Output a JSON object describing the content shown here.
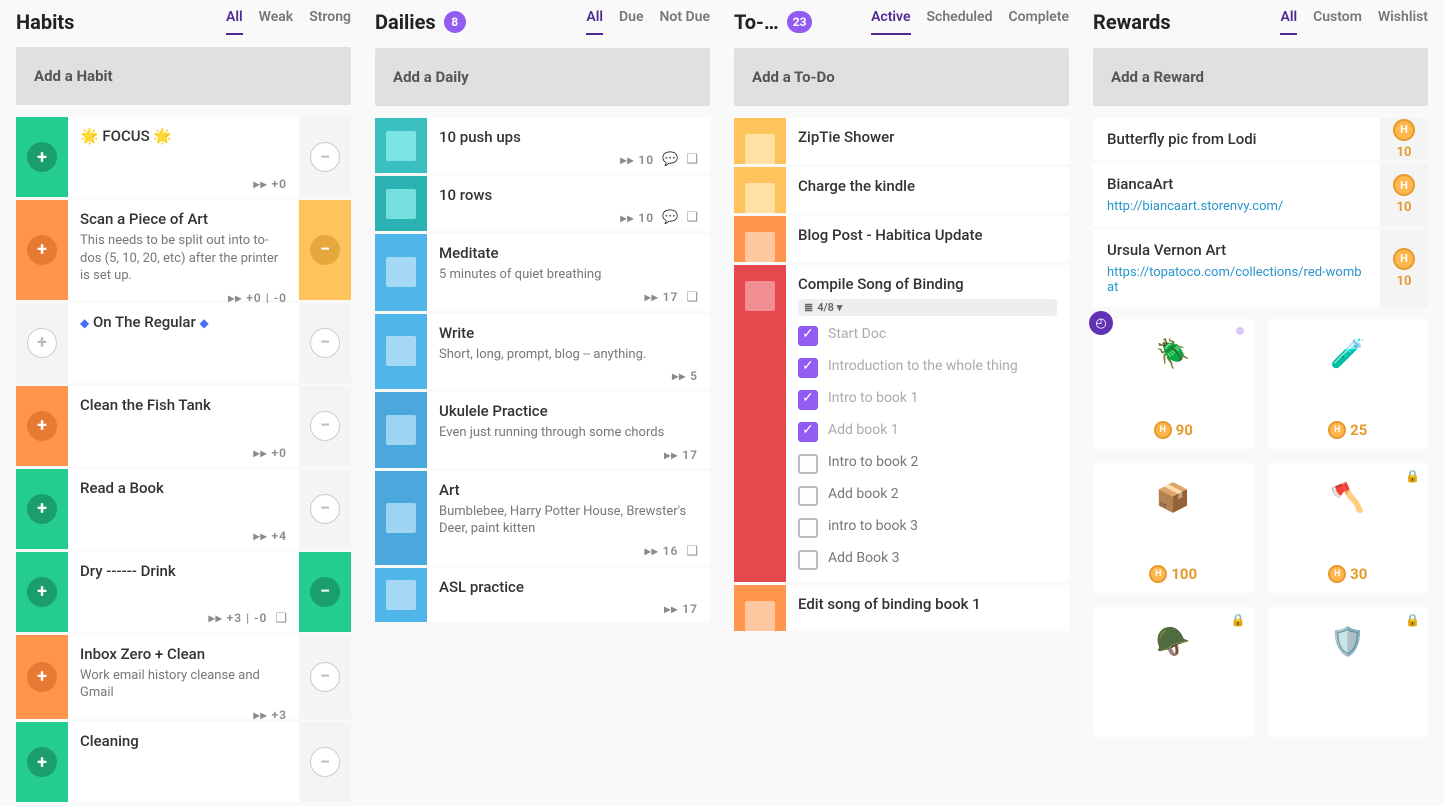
{
  "habits": {
    "title": "Habits",
    "tabs": [
      "All",
      "Weak",
      "Strong"
    ],
    "active_tab": 0,
    "add_placeholder": "Add a Habit",
    "items": [
      {
        "title": "🌟 FOCUS 🌟",
        "note": "",
        "footer": "▸▸ +0",
        "plus": "green",
        "minus": "disabled"
      },
      {
        "title": "Scan a Piece of Art",
        "note": "This needs to be split out into to-dos (5, 10, 20, etc) after the printer is set up.",
        "footer": "▸▸ +0 | -0",
        "plus": "orange",
        "minus": "orange"
      },
      {
        "title_html": "◆ On The Regular ◆",
        "note": "",
        "footer": "",
        "plus": "disabled",
        "minus": "disabled",
        "diamond": true
      },
      {
        "title": "Clean the Fish Tank",
        "note": "",
        "footer": "▸▸ +0",
        "plus": "orange",
        "minus": "disabled"
      },
      {
        "title": "Read a Book",
        "note": "",
        "footer": "▸▸ +4",
        "plus": "green",
        "minus": "disabled"
      },
      {
        "title": "Dry ------ Drink",
        "note": "",
        "footer": "▸▸ +3 | -0",
        "footer_tag": true,
        "plus": "green",
        "minus": "green"
      },
      {
        "title": "Inbox Zero + Clean",
        "note": "Work email history cleanse and Gmail",
        "footer": "▸▸ +3",
        "plus": "orange",
        "minus": "disabled"
      },
      {
        "title": "Cleaning",
        "note": "",
        "footer": "",
        "plus": "green",
        "minus": "disabled"
      }
    ]
  },
  "dailies": {
    "title": "Dailies",
    "badge": "8",
    "tabs": [
      "All",
      "Due",
      "Not Due"
    ],
    "active_tab": 0,
    "add_placeholder": "Add a Daily",
    "items": [
      {
        "title": "10 push ups",
        "note": "",
        "footer": "▸▸ 10",
        "comment": true,
        "tag": true,
        "color": "teal-dark"
      },
      {
        "title": "10 rows",
        "note": "",
        "footer": "▸▸ 10",
        "comment": true,
        "tag": true,
        "color": "teal"
      },
      {
        "title": "Meditate",
        "note": "5 minutes of quiet breathing",
        "footer": "▸▸ 17",
        "tag": true,
        "color": "blue"
      },
      {
        "title": "Write",
        "note": "Short, long, prompt, blog -- anything.",
        "footer": "▸▸ 5",
        "color": "blue"
      },
      {
        "title": "Ukulele Practice",
        "note": "Even just running through some chords",
        "footer": "▸▸ 17",
        "color": "blue2"
      },
      {
        "title": "Art",
        "note": "Bumblebee, Harry Potter House, Brewster's Deer, paint kitten",
        "footer": "▸▸ 16",
        "tag": true,
        "color": "blue2"
      },
      {
        "title": "ASL practice",
        "note": "",
        "footer": "▸▸ 17",
        "color": "blue"
      }
    ]
  },
  "todos": {
    "title": "To-…",
    "badge": "23",
    "tabs": [
      "Active",
      "Scheduled",
      "Complete"
    ],
    "active_tab": 0,
    "add_placeholder": "Add a To-Do",
    "items": [
      {
        "title": "ZipTie Shower",
        "color": "y1"
      },
      {
        "title": "Charge the kindle",
        "color": "y1"
      },
      {
        "title": "Blog Post - Habitica Update",
        "color": "o1"
      },
      {
        "title": "Compile Song of Binding",
        "color": "r1",
        "checklist_badge": "4/8 ▾",
        "checklist": [
          {
            "text": "Start Doc",
            "done": true
          },
          {
            "text": "Introduction to the whole thing",
            "done": true
          },
          {
            "text": "Intro to book 1",
            "done": true
          },
          {
            "text": "Add book 1",
            "done": true
          },
          {
            "text": "Intro to book 2",
            "done": false
          },
          {
            "text": "Add book 2",
            "done": false
          },
          {
            "text": "intro to book 3",
            "done": false
          },
          {
            "text": "Add Book 3",
            "done": false
          }
        ]
      },
      {
        "title": "Edit song of binding book 1",
        "color": "o1"
      }
    ]
  },
  "rewards": {
    "title": "Rewards",
    "tabs": [
      "All",
      "Custom",
      "Wishlist"
    ],
    "active_tab": 0,
    "add_placeholder": "Add a Reward",
    "custom": [
      {
        "title": "Butterfly pic from Lodi",
        "link": "",
        "cost": "10"
      },
      {
        "title": "BiancaArt",
        "link": "http://biancaart.storenvy.com/",
        "cost": "10"
      },
      {
        "title": "Ursula Vernon Art",
        "link": "https://topatoco.com/collections/red-wombat",
        "cost": "10"
      }
    ],
    "shop": [
      {
        "price": "90",
        "clock": true,
        "pin": true,
        "emoji": "🪲"
      },
      {
        "price": "25",
        "emoji": "🧪"
      },
      {
        "price": "100",
        "emoji": "📦"
      },
      {
        "price": "30",
        "lock": true,
        "emoji": "🪓"
      },
      {
        "price": "",
        "lock": true,
        "emoji": "🪖"
      },
      {
        "price": "",
        "lock": true,
        "emoji": "🛡️"
      }
    ]
  }
}
